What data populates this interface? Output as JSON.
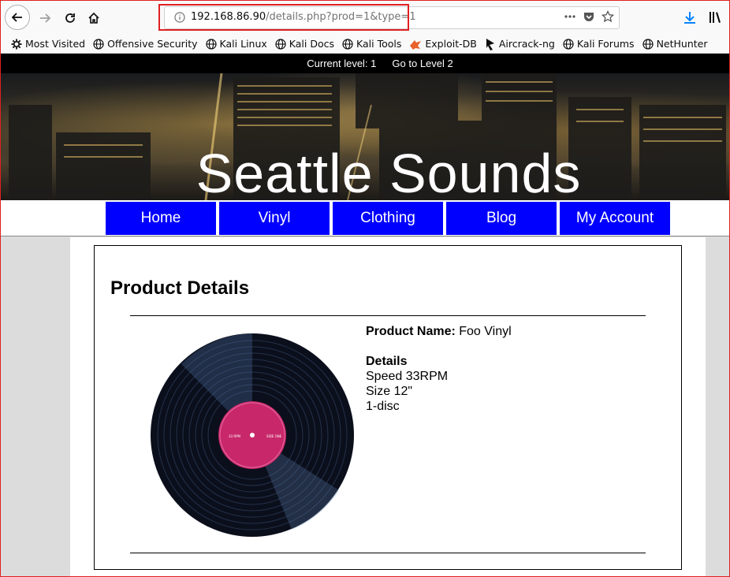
{
  "browser": {
    "url_host": "192.168.86.90",
    "url_path": "/details.php?prod=1&type=1"
  },
  "bookmarks": [
    {
      "label": "Most Visited",
      "icon": "gear-icon"
    },
    {
      "label": "Offensive Security",
      "icon": "globe-icon"
    },
    {
      "label": "Kali Linux",
      "icon": "globe-icon"
    },
    {
      "label": "Kali Docs",
      "icon": "globe-icon"
    },
    {
      "label": "Kali Tools",
      "icon": "globe-icon"
    },
    {
      "label": "Exploit-DB",
      "icon": "exploitdb-icon"
    },
    {
      "label": "Aircrack-ng",
      "icon": "aircrack-icon"
    },
    {
      "label": "Kali Forums",
      "icon": "globe-icon"
    },
    {
      "label": "NetHunter",
      "icon": "globe-icon"
    }
  ],
  "topbar": {
    "current_level": "Current level: 1",
    "goto_level": "Go to Level 2"
  },
  "banner": {
    "title": "Seattle Sounds"
  },
  "menu": {
    "items": [
      "Home",
      "Vinyl",
      "Clothing",
      "Blog",
      "My Account"
    ]
  },
  "product": {
    "heading": "Product Details",
    "name_label": "Product Name:",
    "name_value": "Foo Vinyl",
    "details_label": "Details",
    "speed": "Speed 33RPM",
    "size": "Size 12\"",
    "discs": "1-disc"
  },
  "colors": {
    "menu_bg": "#0000ff",
    "highlight_red": "#e02020",
    "page_bg": "#dcdcdc"
  }
}
